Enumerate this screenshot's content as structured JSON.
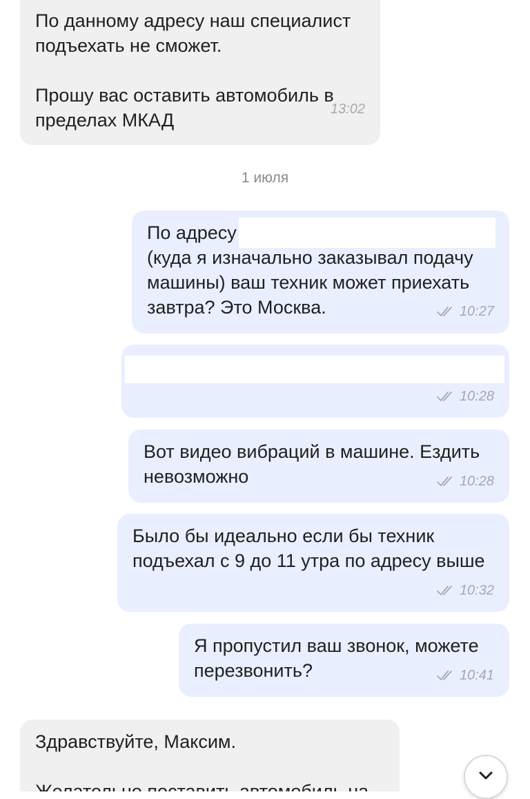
{
  "messages": [
    {
      "direction": "incoming",
      "text": "По данному адресу наш специалист\nподъехать не сможет.\n\nПрошу вас оставить автомобиль в\nпределах МКАД",
      "time": "13:02"
    },
    {
      "direction": "outgoing",
      "text": "По адресу\n(куда я изначально заказывал подачу\nмашины) ваш техник может приехать\nзавтра? Это Москва.",
      "time": "10:27",
      "status_icon": "double-check-icon"
    },
    {
      "direction": "outgoing",
      "text": "",
      "time": "10:28",
      "status_icon": "double-check-icon"
    },
    {
      "direction": "outgoing",
      "text": "Вот видео вибраций в машине. Ездить\nневозможно",
      "time": "10:28",
      "status_icon": "double-check-icon"
    },
    {
      "direction": "outgoing",
      "text": "Было бы идеально если бы техник\nподъехал с 9 до 11 утра по адресу выше",
      "time": "10:32",
      "status_icon": "double-check-icon"
    },
    {
      "direction": "outgoing",
      "text": "Я пропустил ваш звонок, можете\nперезвонить?",
      "time": "10:41",
      "status_icon": "double-check-icon"
    },
    {
      "direction": "incoming",
      "text": "Здравствуйте, Максим.\n\nЖелательно поставить автомобиль на"
    }
  ],
  "date_separator": "1 июля",
  "scroll_button": {
    "icon": "chevron-down-icon"
  },
  "colors": {
    "incoming_bubble": "#f0f0f0",
    "outgoing_bubble": "#e9efff",
    "time_text": "#a4a8b2",
    "date_text": "#8a8a8a"
  }
}
